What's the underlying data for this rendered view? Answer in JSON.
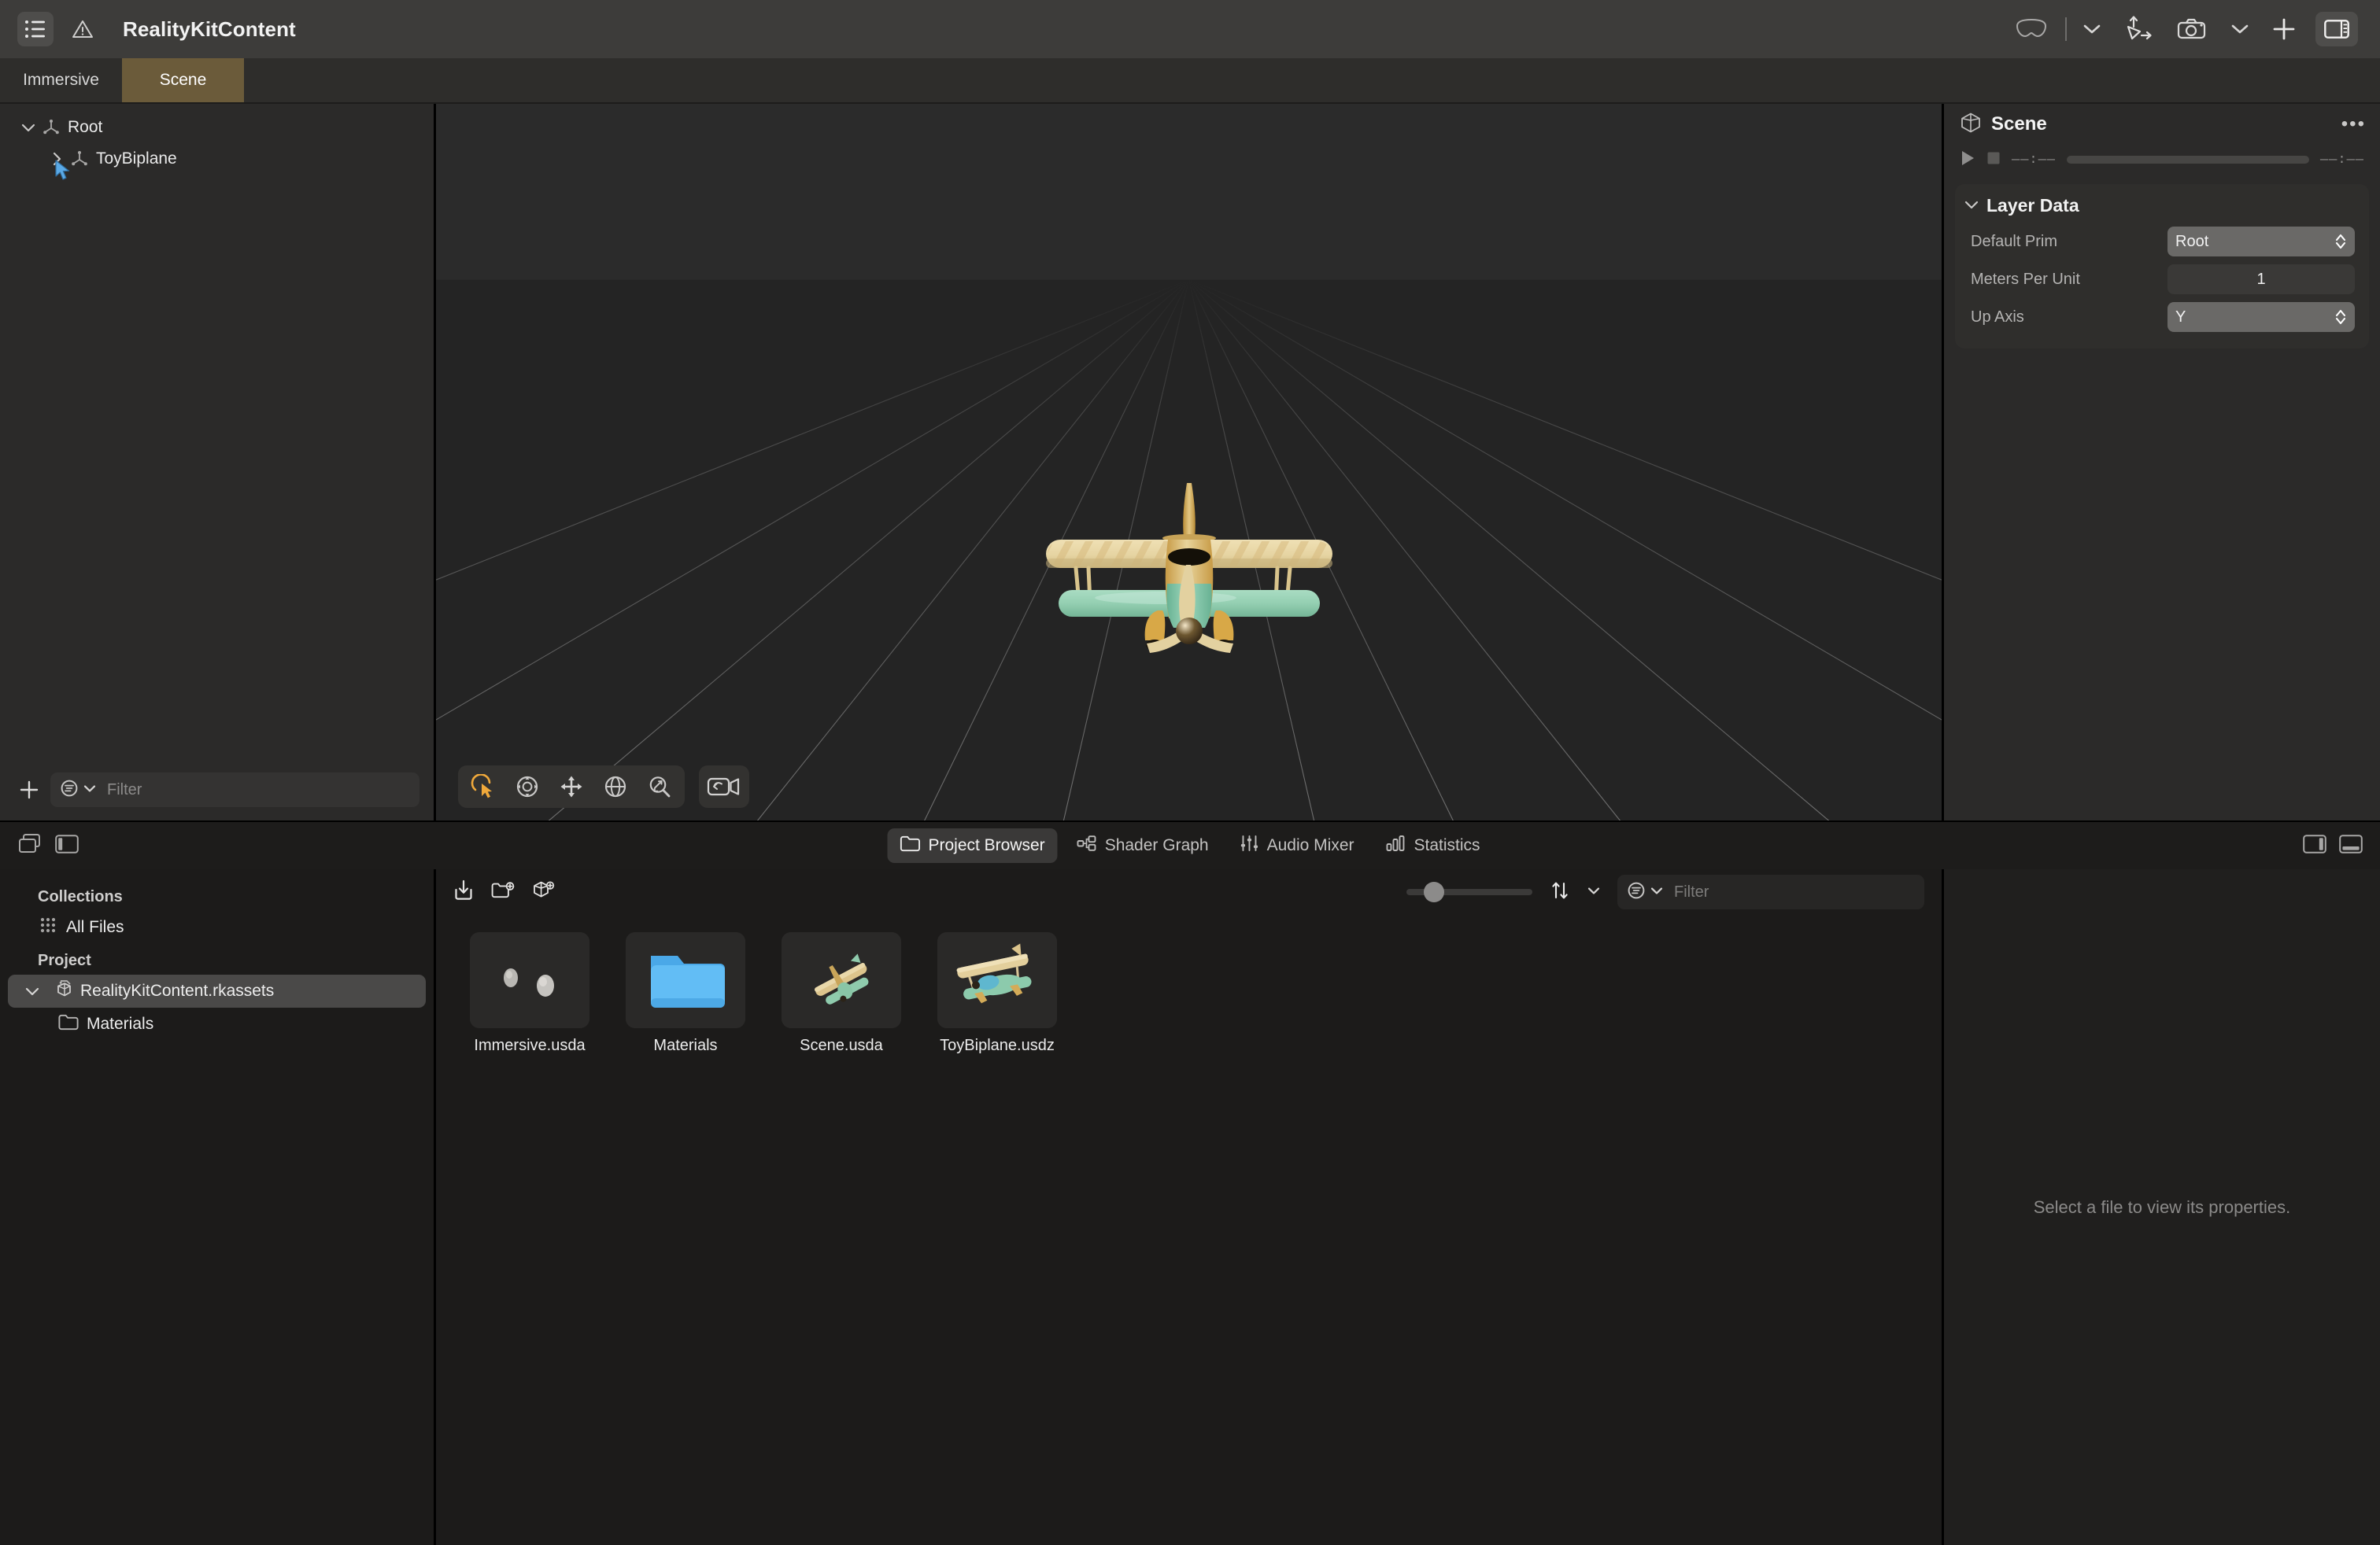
{
  "window": {
    "title": "RealityKitContent",
    "sidebar_toggle_icon": "list-sidebar-icon",
    "warning_icon": "warning-triangle-icon"
  },
  "toolbar": {
    "items": [
      {
        "name": "vision-pro-preview-icon",
        "label": ""
      },
      {
        "name": "preview-chevron-icon",
        "label": ""
      },
      {
        "name": "play-to-device-icon",
        "label": ""
      },
      {
        "name": "camera-icon",
        "label": ""
      },
      {
        "name": "camera-chevron-icon",
        "label": ""
      },
      {
        "name": "add-icon",
        "label": ""
      },
      {
        "name": "inspector-toggle-icon",
        "label": ""
      }
    ]
  },
  "document_tabs": [
    {
      "label": "Immersive",
      "active": false
    },
    {
      "label": "Scene",
      "active": true
    }
  ],
  "hierarchy": {
    "nodes": [
      {
        "label": "Root",
        "depth": 0,
        "expanded": true,
        "icon": "prim-axes-icon"
      },
      {
        "label": "ToyBiplane",
        "depth": 1,
        "expanded": false,
        "icon": "prim-axes-icon"
      }
    ],
    "add_button": "add-entity-button",
    "filter_placeholder": "Filter"
  },
  "viewport": {
    "tools": [
      {
        "name": "select-tool",
        "label": "Select",
        "active": true
      },
      {
        "name": "orbit-tool",
        "label": "Orbit",
        "active": false
      },
      {
        "name": "pan-tool",
        "label": "Pan",
        "active": false
      },
      {
        "name": "rotate-tool",
        "label": "Rotate",
        "active": false
      },
      {
        "name": "zoom-tool",
        "label": "Zoom",
        "active": false
      }
    ],
    "camera_reset": {
      "name": "reset-camera-button",
      "label": "Reset Camera"
    },
    "model": "ToyBiplane"
  },
  "inspector": {
    "title": "Scene",
    "header_icon": "prim-cube-icon",
    "more_button": "•••",
    "transport": {
      "play_icon": "play-icon",
      "stop_icon": "stop-icon",
      "current_time": "——:——",
      "total_time": "——:——"
    },
    "section": {
      "title": "Layer Data",
      "expanded": true,
      "rows": [
        {
          "label": "Default Prim",
          "value": "Root",
          "control": "popup"
        },
        {
          "label": "Meters Per Unit",
          "value": "1",
          "control": "number"
        },
        {
          "label": "Up Axis",
          "value": "Y",
          "control": "popup"
        }
      ]
    }
  },
  "bottom_bar": {
    "left_icons": [
      {
        "name": "collections-panel-toggle-icon"
      },
      {
        "name": "left-panel-toggle-icon"
      }
    ],
    "tabs": [
      {
        "label": "Project Browser",
        "icon": "folder-icon",
        "active": true
      },
      {
        "label": "Shader Graph",
        "icon": "shader-graph-icon",
        "active": false
      },
      {
        "label": "Audio Mixer",
        "icon": "audio-mixer-icon",
        "active": false
      },
      {
        "label": "Statistics",
        "icon": "statistics-icon",
        "active": false
      }
    ],
    "right_icons": [
      {
        "name": "right-panel-toggle-icon"
      },
      {
        "name": "bottom-panel-toggle-icon"
      }
    ]
  },
  "collections": {
    "groups": [
      {
        "header": "Collections",
        "rows": [
          {
            "label": "All Files",
            "icon": "all-files-icon",
            "depth": 1,
            "selected": false,
            "twisty": ""
          }
        ]
      },
      {
        "header": "Project",
        "rows": [
          {
            "label": "RealityKitContent.rkassets",
            "icon": "rkassets-icon",
            "depth": 0,
            "selected": true,
            "twisty": "⌄"
          },
          {
            "label": "Materials",
            "icon": "folder-icon",
            "depth": 1,
            "selected": false,
            "twisty": ""
          }
        ]
      }
    ]
  },
  "browser_toolbar": {
    "icons": [
      {
        "name": "import-icon"
      },
      {
        "name": "new-folder-icon"
      },
      {
        "name": "new-asset-icon"
      }
    ],
    "zoom_slider": {
      "name": "thumbnail-size-slider",
      "value": 18
    },
    "sort_icon": "sort-icon",
    "sort_chevron": "chevron-down-icon",
    "filter_icon": "filter-icon",
    "filter_chevron": "chevron-down-icon",
    "filter_placeholder": "Filter"
  },
  "files": [
    {
      "label": "Immersive.usda",
      "thumb": "spheres-scene-thumb"
    },
    {
      "label": "Materials",
      "thumb": "blue-folder-thumb"
    },
    {
      "label": "Scene.usda",
      "thumb": "small-biplane-thumb"
    },
    {
      "label": "ToyBiplane.usdz",
      "thumb": "large-biplane-thumb"
    }
  ],
  "file_inspector": {
    "empty_message": "Select a file to view its properties."
  },
  "colors": {
    "accent_tab": "#6b5b3a",
    "titlebar": "#3d3c3a",
    "panel": "#2b2a29",
    "viewport": "#252525",
    "bottom_panel": "#1c1b1a",
    "select_tool_active": "#f0a93b",
    "folder_blue": "#5bb6f0",
    "selection": "#4a4948",
    "cursor": "#5aa9e6"
  }
}
